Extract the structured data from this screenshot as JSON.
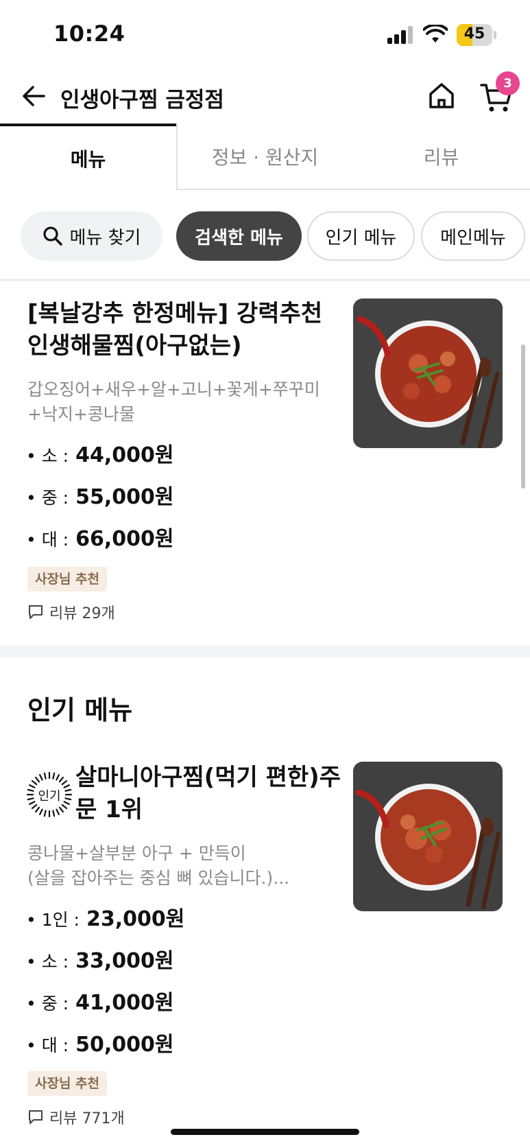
{
  "status_bar": {
    "time": "10:24",
    "battery": "45",
    "battery_level": 0.45
  },
  "header": {
    "store_name": "인생아구찜 금정점",
    "cart_count": "3"
  },
  "tabs": [
    {
      "label": "메뉴",
      "active": true
    },
    {
      "label": "정보 · 원산지",
      "active": false
    },
    {
      "label": "리뷰",
      "active": false
    }
  ],
  "chips": {
    "search": "메뉴 찾기",
    "searched": "검색한 메뉴",
    "popular": "인기 메뉴",
    "main": "메인메뉴"
  },
  "items": [
    {
      "name": "[복날강추 한정메뉴] 강력추천 인생해물찜(아구없는)",
      "description": "갑오징어+새우+알+고니+꽃게+쭈꾸미+낙지+콩나물",
      "prices": [
        {
          "label": "• 소 :",
          "value": "44,000원"
        },
        {
          "label": "• 중 :",
          "value": "55,000원"
        },
        {
          "label": "• 대 :",
          "value": "66,000원"
        }
      ],
      "badge": "사장님 추천",
      "reviews": "리뷰 29개"
    },
    {
      "seal": "인기",
      "name": "살마니아구찜(먹기 편한)주문 1위",
      "description": "콩나물+살부분 아구 + 만득이\n(살을 잡아주는 중심 뼈 있습니다.)...",
      "prices": [
        {
          "label": "• 1인 :",
          "value": "23,000원"
        },
        {
          "label": "• 소 :",
          "value": "33,000원"
        },
        {
          "label": "• 중 :",
          "value": "41,000원"
        },
        {
          "label": "• 대 :",
          "value": "50,000원"
        }
      ],
      "badge": "사장님 추천",
      "reviews": "리뷰 771개"
    }
  ],
  "section": {
    "popular_title": "인기 메뉴"
  },
  "colors": {
    "accent_badge": "#e8468f",
    "chip_dark": "#444444",
    "owner_badge_bg": "#f6ede4"
  }
}
